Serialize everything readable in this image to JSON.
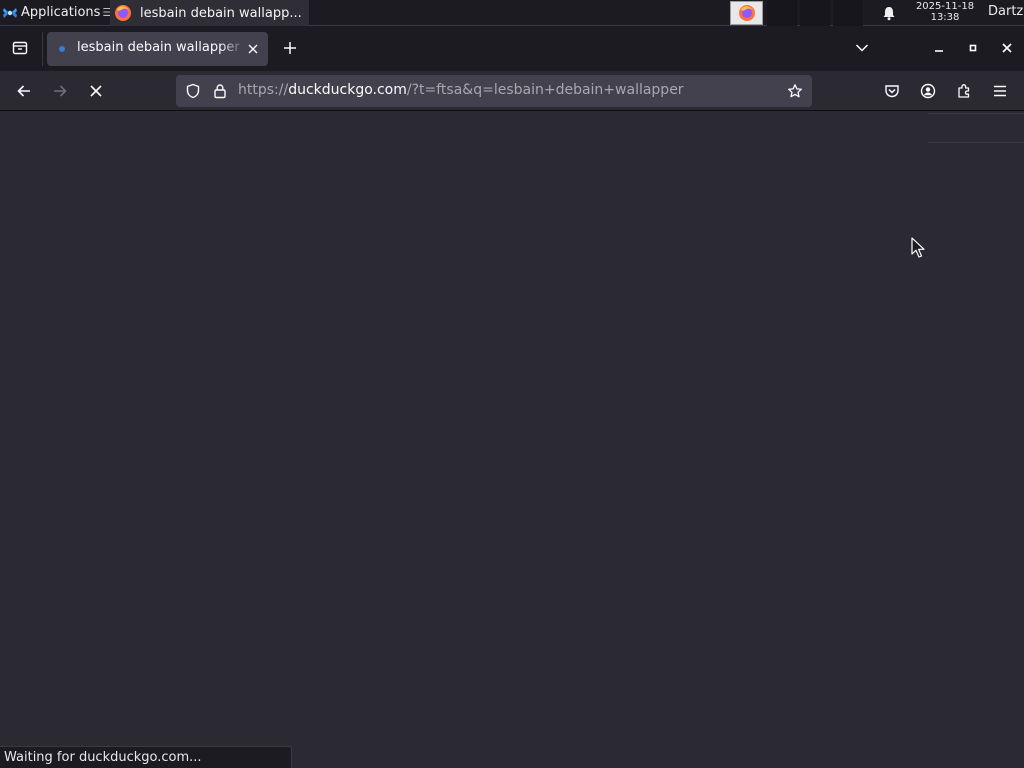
{
  "taskbar": {
    "apps_label": "Applications",
    "window_title": "lesbain debain wallapp...",
    "clock_date": "2025-11-18",
    "clock_time": "13:38",
    "user": "Dartz"
  },
  "browser": {
    "tab_title": "lesbain debain wallapper",
    "url_prefix": "https://",
    "url_host": "duckduckgo.com",
    "url_rest": "/?t=ftsa&q=lesbain+debain+wallapper",
    "status_text": "Waiting for duckduckgo.com..."
  },
  "theme": {
    "accent": "#3a7bd5",
    "background": "#2b2a33",
    "toolbar_dark": "#1c1b22",
    "urlbar": "#42414d"
  },
  "icons": {
    "apps": "xfce-mouse-icon",
    "firefox": "firefox-icon",
    "notifications": "bell-icon",
    "tabs_view": "firefox-view-icon",
    "back": "back-arrow-icon",
    "forward": "forward-arrow-icon",
    "stop": "stop-x-icon",
    "shield": "tracking-shield-icon",
    "lock": "lock-icon",
    "bookmark": "star-icon",
    "pocket": "pocket-icon",
    "account": "account-icon",
    "extensions": "puzzle-icon",
    "menu": "hamburger-menu-icon"
  }
}
